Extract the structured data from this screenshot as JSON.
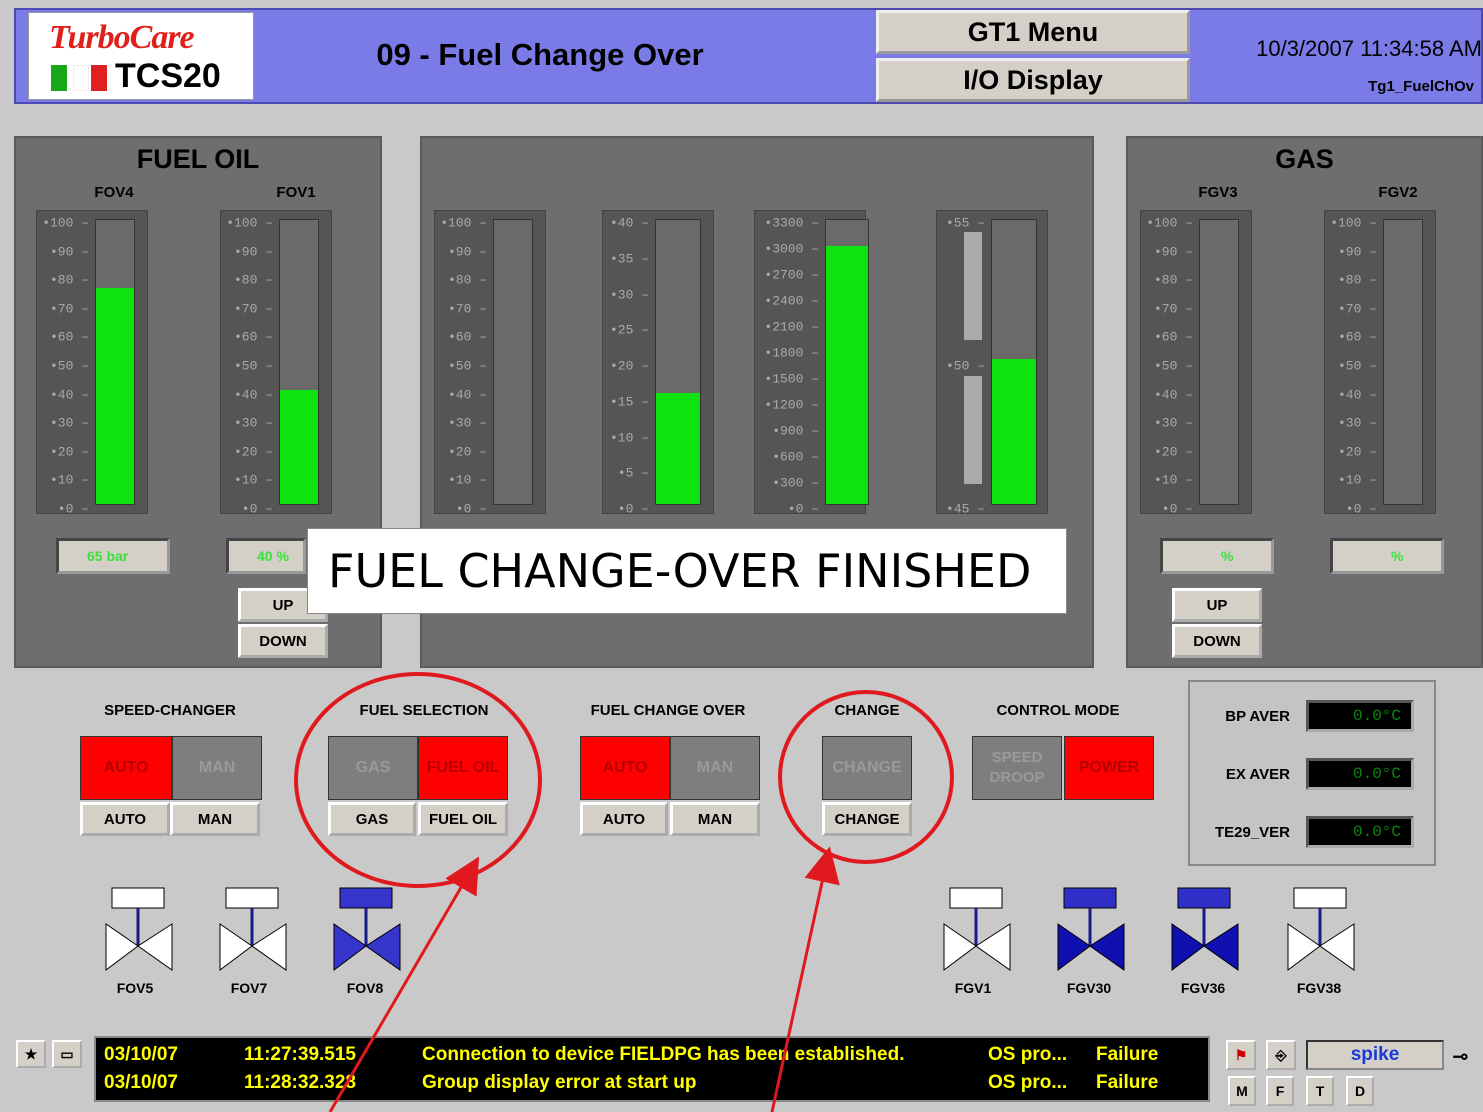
{
  "header": {
    "logo_brand": "TurboCare",
    "logo_product": "TCS20",
    "title": "09 - Fuel Change Over",
    "menu_button": "GT1 Menu",
    "io_button": "I/O Display",
    "datetime": "10/3/2007 11:34:58 AM",
    "screen_id": "Tg1_FuelChOv"
  },
  "fuel_oil": {
    "title": "FUEL OIL",
    "gauge1_label": "FOV4",
    "gauge2_label": "FOV1",
    "value1": "65 bar",
    "value2": "40 %",
    "up": "UP",
    "down": "DOWN"
  },
  "gas": {
    "title": "GAS",
    "gauge1_label": "FGV3",
    "gauge2_label": "FGV2",
    "value1": "%",
    "value2": "%",
    "up": "UP",
    "down": "DOWN"
  },
  "gauges": {
    "pct_scale": [
      "100",
      "90",
      "80",
      "70",
      "60",
      "50",
      "40",
      "30",
      "20",
      "10",
      "0"
    ],
    "fov4_level": 0.76,
    "fov1_level": 0.4,
    "center1_level": 0.0,
    "center2_scale": [
      "40",
      "35",
      "30",
      "25",
      "20",
      "15",
      "10",
      "5",
      "0"
    ],
    "center2_level": 0.39,
    "center3_scale": [
      "3300",
      "3000",
      "2700",
      "2400",
      "2100",
      "1800",
      "1500",
      "1200",
      "900",
      "600",
      "300",
      "0"
    ],
    "center3_level": 0.91,
    "center4_scale": [
      "55",
      "50",
      "45"
    ],
    "center4_level": 0.51,
    "fgv3_level": 0.0,
    "fgv2_level": 0.0
  },
  "overlay_message": "FUEL CHANGE-OVER FINISHED",
  "controls": {
    "speed_changer": {
      "label": "SPEED-CHANGER",
      "left": "AUTO",
      "right": "MAN",
      "btn_left": "AUTO",
      "btn_right": "MAN"
    },
    "fuel_selection": {
      "label": "FUEL SELECTION",
      "left": "GAS",
      "right": "FUEL OIL",
      "btn_left": "GAS",
      "btn_right": "FUEL OIL"
    },
    "fuel_change_over": {
      "label": "FUEL CHANGE OVER",
      "left": "AUTO",
      "right": "MAN",
      "btn_left": "AUTO",
      "btn_right": "MAN"
    },
    "change": {
      "label": "CHANGE",
      "indicator": "CHANGE",
      "btn": "CHANGE"
    },
    "control_mode": {
      "label": "CONTROL MODE",
      "left": "SPEED DROOP",
      "right": "POWER"
    }
  },
  "temps": [
    {
      "label": "BP AVER",
      "value": "0.0°C"
    },
    {
      "label": "EX AVER",
      "value": "0.0°C"
    },
    {
      "label": "TE29_VER",
      "value": "0.0°C"
    }
  ],
  "valves": {
    "fov5": "FOV5",
    "fov7": "FOV7",
    "fov8": "FOV8",
    "fgv1": "FGV1",
    "fgv30": "FGV30",
    "fgv36": "FGV36",
    "fgv38": "FGV38"
  },
  "alarms": [
    {
      "date": "03/10/07",
      "time": "11:27:39.515",
      "text": "Connection to device FIELDPG has been established.",
      "source": "OS pro...",
      "status": "Failure"
    },
    {
      "date": "03/10/07",
      "time": "11:28:32.328",
      "text": "Group display error at start up",
      "source": "OS pro...",
      "status": "Failure"
    }
  ],
  "toolbar": {
    "user": "spike",
    "m": "M",
    "f": "F",
    "t": "T",
    "d": "D"
  },
  "colors": {
    "header_bg": "#7b7be8",
    "active_red": "#ff0000",
    "fill_green": "#0fe30f",
    "valve_open": "#1010b0",
    "annotation_red": "#e0191e"
  }
}
